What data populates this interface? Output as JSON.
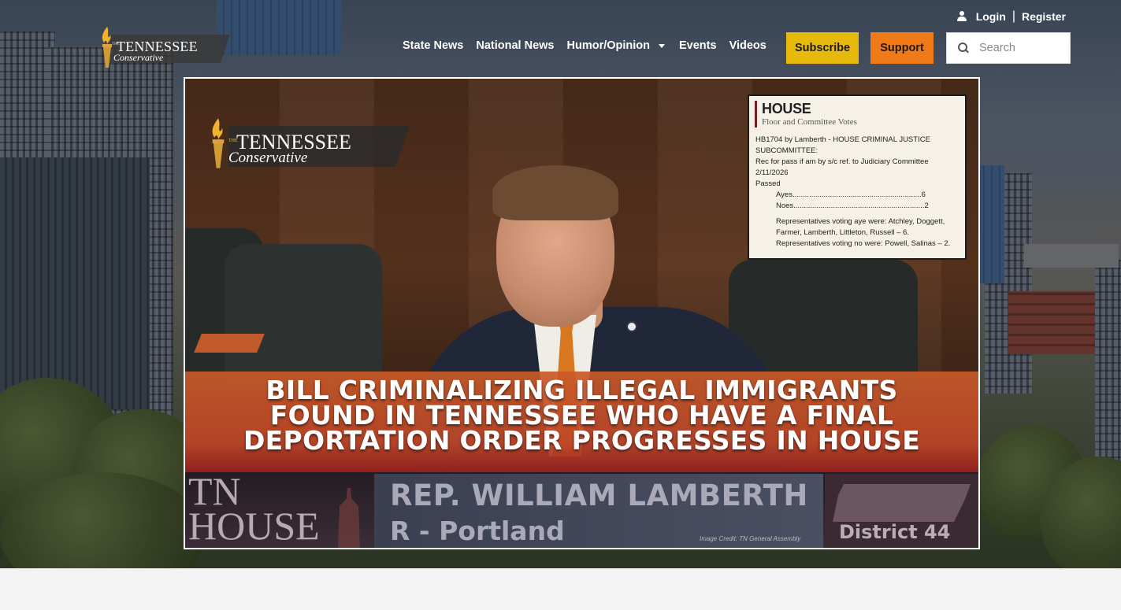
{
  "header": {
    "logo": {
      "the": "THE",
      "name": "TENNESSEE",
      "sub": "Conservative"
    },
    "auth": {
      "login": "Login",
      "separator": "|",
      "register": "Register"
    },
    "nav": [
      {
        "label": "State News"
      },
      {
        "label": "National News"
      },
      {
        "label": "Humor/Opinion",
        "has_dropdown": true
      },
      {
        "label": "Events"
      },
      {
        "label": "Videos"
      }
    ],
    "subscribe_label": "Subscribe",
    "support_label": "Support",
    "search": {
      "placeholder": "Search",
      "value": ""
    }
  },
  "feature": {
    "logo": {
      "the": "THE",
      "name": "TENNESSEE",
      "sub": "Conservative"
    },
    "vote_card": {
      "title": "HOUSE",
      "subtitle": "Floor and Committee Votes",
      "lines": [
        "HB1704 by Lamberth - HOUSE CRIMINAL JUSTICE SUBCOMMITTEE:",
        "Rec for pass if am by s/c ref. to Judiciary Committee",
        "2/11/2026",
        "Passed"
      ],
      "ayes": "Ayes..............................................................6",
      "noes": "Noes...............................................................2",
      "aye_voters": "Representatives voting aye were: Atchley, Doggett, Farmer, Lamberth, Littleton, Russell – 6.",
      "no_voters": "Representatives voting no were: Powell, Salinas – 2."
    },
    "headline_lines": [
      "BILL CRIMINALIZING ILLEGAL IMMIGRANTS",
      "FOUND IN TENNESSEE WHO HAVE A FINAL",
      "DEPORTATION ORDER PROGRESSES IN HOUSE"
    ],
    "lower_third": {
      "tn": "TN",
      "house": "HOUSE",
      "rep_name": "REP. WILLIAM LAMBERTH",
      "rep_party": "R - Portland",
      "district": "District 44",
      "credit": "Image Credit: TN General Assembly"
    }
  },
  "colors": {
    "subscribe": "#e8b90d",
    "support": "#f07a17",
    "headline_band": "#c85a28"
  }
}
